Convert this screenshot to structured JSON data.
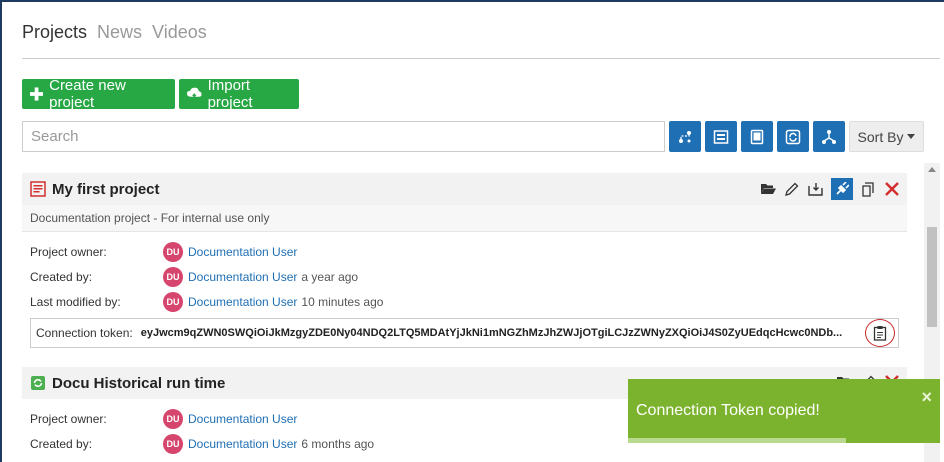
{
  "tabs": [
    {
      "label": "Projects",
      "active": true
    },
    {
      "label": "News",
      "active": false
    },
    {
      "label": "Videos",
      "active": false
    }
  ],
  "toolbar": {
    "create_label": "Create new project",
    "import_label": "Import project",
    "search_placeholder": "Search",
    "sort_label": "Sort By",
    "view_icons": [
      "connections-icon",
      "board-icon",
      "tablet-icon",
      "refresh-icon",
      "hierarchy-icon"
    ]
  },
  "projects": [
    {
      "title": "My first project",
      "icon": "document-project-icon",
      "icon_color": "#d32f2f",
      "description": "Documentation project - For internal use only",
      "owner_label": "Project owner:",
      "owner_initials": "DU",
      "owner_name": "Documentation User",
      "created_label": "Created by:",
      "created_initials": "DU",
      "created_name": "Documentation User",
      "created_ago": "a year ago",
      "modified_label": "Last modified by:",
      "modified_initials": "DU",
      "modified_name": "Documentation User",
      "modified_ago": "10 minutes ago",
      "token_label": "Connection token:",
      "token_value": "eyJwcm9qZWN0SWQiOiJkMzgyZDE0Ny04NDQ2LTQ5MDAtYjJkNi1mNGZhMzJhZWJjOTgiLCJzZWNyZXQiOiJ4S0ZyUEdqcHcwc0NDb..."
    },
    {
      "title": "Docu Historical run time",
      "icon": "refresh-project-icon",
      "icon_color": "#4caf50",
      "owner_label": "Project owner:",
      "owner_initials": "DU",
      "owner_name": "Documentation User",
      "created_label": "Created by:",
      "created_initials": "DU",
      "created_name": "Documentation User",
      "created_ago": "6 months ago"
    }
  ],
  "toast": {
    "message": "Connection Token copied!",
    "close": "×",
    "progress": 0.7
  },
  "colors": {
    "primary": "#1f6fb4",
    "success": "#28a745",
    "toast": "#7cb32e",
    "avatar": "#d6456e",
    "danger": "#d32f2f"
  }
}
